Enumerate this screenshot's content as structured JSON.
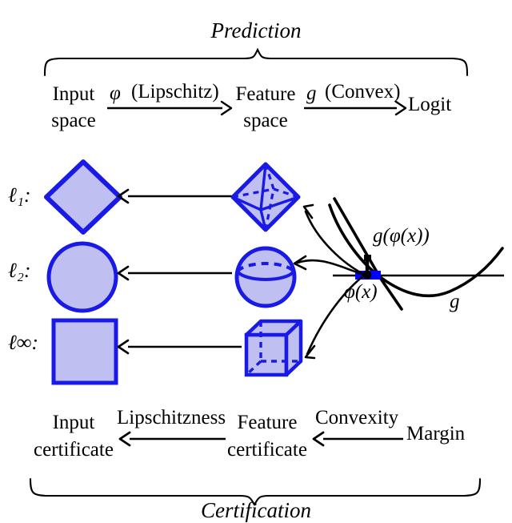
{
  "figure": {
    "title_top": "Prediction",
    "title_bottom": "Certification",
    "accent_blue": "#1a1ae6",
    "fill_blue": "#bfbff2",
    "line_black": "#000000"
  },
  "prediction_row": {
    "node_input": "Input\nspace",
    "node_input_line1": "Input",
    "node_input_line2": "space",
    "arrow1_label_fn": "φ",
    "arrow1_label_prop": "(Lipschitz)",
    "node_feature_line1": "Feature",
    "node_feature_line2": "space",
    "arrow2_label_fn": "g",
    "arrow2_label_prop": "(Convex)",
    "node_logit": "Logit"
  },
  "norm_rows": [
    {
      "label": "ℓ₁:",
      "shape2d": "diamond",
      "shape3d": "octahedron"
    },
    {
      "label": "ℓ₂:",
      "shape2d": "circle",
      "shape3d": "sphere"
    },
    {
      "label": "ℓ∞:",
      "shape2d": "square",
      "shape3d": "cube"
    }
  ],
  "plot": {
    "label_point": "φ(x)",
    "label_value": "g(φ(x))",
    "label_curve": "g"
  },
  "certification_row": {
    "node_input_line1": "Input",
    "node_input_line2": "certificate",
    "arrow1_label": "Lipschitzness",
    "node_feature_line1": "Feature",
    "node_feature_line2": "certificate",
    "arrow2_label": "Convexity",
    "node_margin": "Margin"
  }
}
